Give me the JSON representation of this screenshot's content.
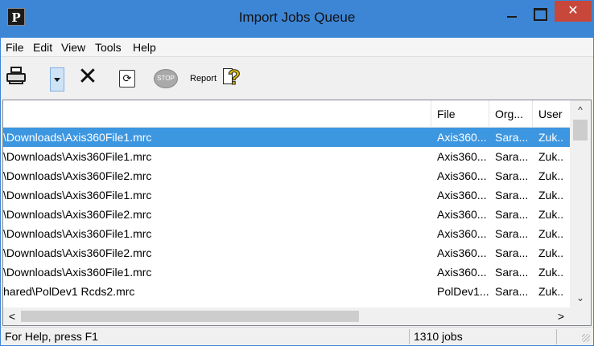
{
  "window": {
    "title": "Import Jobs Queue",
    "app_icon_letter": "P",
    "close_glyph": "✕"
  },
  "menu": {
    "items": [
      "File",
      "Edit",
      "View",
      "Tools",
      "Help"
    ]
  },
  "toolbar": {
    "icons": [
      "printer-icon",
      "dropdown-arrow-icon",
      "cut-icon",
      "refresh-icon",
      "stop-icon",
      "help-icon"
    ],
    "refresh_glyph": "⟳",
    "stop_label": "STOP",
    "report_label": "Report",
    "help_glyph": "?"
  },
  "table": {
    "columns": [
      "",
      "File",
      "Org...",
      "User"
    ],
    "rows": [
      {
        "path": "\\Downloads\\Axis360File1.mrc",
        "file": "Axis360...",
        "org": "Sara...",
        "user": "Zuk..",
        "selected": true
      },
      {
        "path": "\\Downloads\\Axis360File1.mrc",
        "file": "Axis360...",
        "org": "Sara...",
        "user": "Zuk.."
      },
      {
        "path": "\\Downloads\\Axis360File2.mrc",
        "file": "Axis360...",
        "org": "Sara...",
        "user": "Zuk.."
      },
      {
        "path": "\\Downloads\\Axis360File1.mrc",
        "file": "Axis360...",
        "org": "Sara...",
        "user": "Zuk.."
      },
      {
        "path": "\\Downloads\\Axis360File2.mrc",
        "file": "Axis360...",
        "org": "Sara...",
        "user": "Zuk.."
      },
      {
        "path": "\\Downloads\\Axis360File1.mrc",
        "file": "Axis360...",
        "org": "Sara...",
        "user": "Zuk.."
      },
      {
        "path": "\\Downloads\\Axis360File2.mrc",
        "file": "Axis360...",
        "org": "Sara...",
        "user": "Zuk.."
      },
      {
        "path": "\\Downloads\\Axis360File1.mrc",
        "file": "Axis360...",
        "org": "Sara...",
        "user": "Zuk.."
      },
      {
        "path": "hared\\PolDev1 Rcds2.mrc",
        "file": "PolDev1...",
        "org": "Sara...",
        "user": "Zuk.."
      }
    ],
    "scroll_glyphs": {
      "up": "^",
      "down": "⌄",
      "left": "<",
      "right": ">"
    }
  },
  "status": {
    "help_text": "For Help, press F1",
    "job_count": "1310 jobs"
  },
  "colors": {
    "titlebar": "#3d86d6",
    "selection": "#3d96e0",
    "close": "#c7473a"
  }
}
